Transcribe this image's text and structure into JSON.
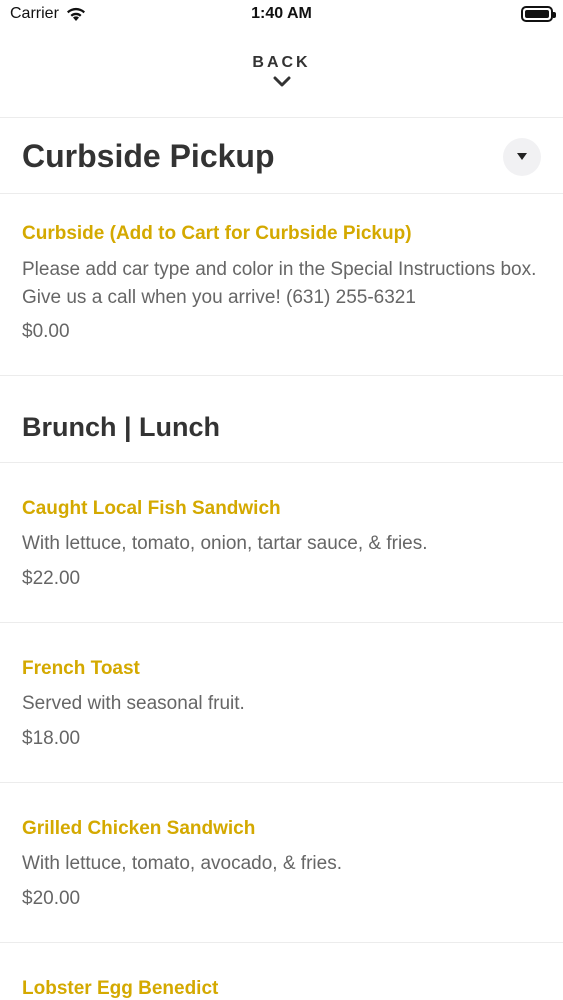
{
  "status_bar": {
    "carrier": "Carrier",
    "time": "1:40 AM"
  },
  "nav": {
    "back_label": "BACK"
  },
  "sections": {
    "curbside": {
      "title": "Curbside Pickup",
      "items": [
        {
          "name": "Curbside (Add to Cart for Curbside Pickup)",
          "description": "Please add car type and color in the Special Instructions box. Give us a call when you arrive! (631) 255-6321",
          "price": "$0.00"
        }
      ]
    },
    "brunch": {
      "title": "Brunch | Lunch",
      "items": [
        {
          "name": "Caught Local Fish Sandwich",
          "description": "With lettuce, tomato, onion, tartar sauce, & fries.",
          "price": "$22.00"
        },
        {
          "name": "French Toast",
          "description": "Served with seasonal fruit.",
          "price": "$18.00"
        },
        {
          "name": "Grilled Chicken Sandwich",
          "description": "With lettuce, tomato, avocado, & fries.",
          "price": "$20.00"
        },
        {
          "name": "Lobster Egg Benedict"
        }
      ]
    }
  },
  "colors": {
    "accent": "#d4a900",
    "text_primary": "#333333",
    "text_secondary": "#666666",
    "divider": "#ececec"
  },
  "icons": {
    "wifi": "wifi-icon",
    "battery": "battery-icon",
    "back": "chevron-down-icon",
    "dropdown": "caret-down-icon"
  }
}
